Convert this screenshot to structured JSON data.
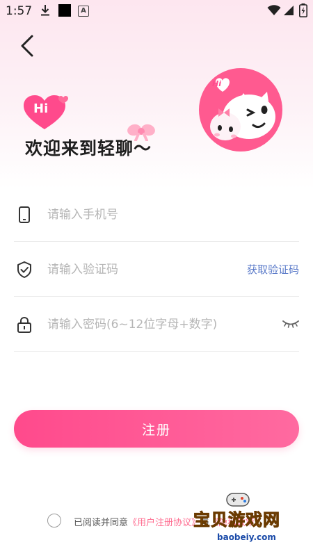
{
  "status_bar": {
    "time": "1:57",
    "notification_badge": "A"
  },
  "header": {
    "title": "欢迎来到轻聊～",
    "hi_badge": "Hi",
    "art_badge": "Hi"
  },
  "form": {
    "phone": {
      "placeholder": "请输入手机号",
      "value": ""
    },
    "code": {
      "placeholder": "请输入验证码",
      "value": "",
      "get_code_label": "获取验证码"
    },
    "password": {
      "placeholder": "请输入密码(6~12位字母+数字)",
      "value": ""
    }
  },
  "register_button": {
    "label": "注册"
  },
  "agreement": {
    "prefix": "已阅读并同意",
    "link1": "《用户注册协议》",
    "connector": "与",
    "link2": "《隐私政策》"
  },
  "watermark": {
    "title": "宝贝游戏网",
    "url": "baobeiy.com"
  },
  "colors": {
    "accent": "#ff4a8c",
    "link": "#5a7ac9",
    "agreement_link": "#ff6a8e"
  }
}
